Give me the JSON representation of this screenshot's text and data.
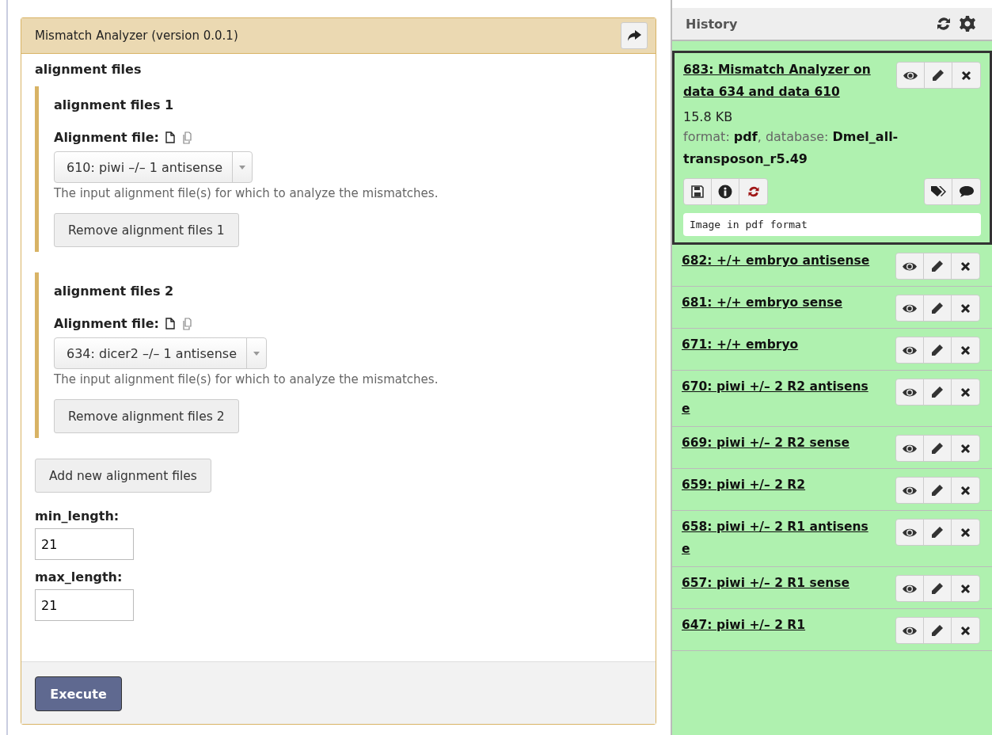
{
  "tool": {
    "title": "Mismatch Analyzer (version 0.0.1)",
    "section_title": "alignment files",
    "repeats": [
      {
        "title": "alignment files 1",
        "field_label": "Alignment file:",
        "value": "610: piwi –/– 1 antisense",
        "help": "The input alignment file(s) for which to analyze the mismatches.",
        "remove_button": "Remove alignment files 1"
      },
      {
        "title": "alignment files 2",
        "field_label": "Alignment file:",
        "value": "634: dicer2 –/– 1 antisense",
        "help": "The input alignment file(s) for which to analyze the mismatches.",
        "remove_button": "Remove alignment files 2"
      }
    ],
    "add_button": "Add new alignment files",
    "params": [
      {
        "label": "min_length:",
        "value": "21"
      },
      {
        "label": "max_length:",
        "value": "21"
      }
    ],
    "execute_button": "Execute"
  },
  "history": {
    "title": "History",
    "items": [
      {
        "title": "683: Mismatch Analyzer on data 634 and data 610",
        "expanded": true,
        "size": "15.8 KB",
        "info": "format: **pdf**, database: **Dmel_all-transposon_r5.49**",
        "peek": "Image in pdf format"
      },
      {
        "title": "682: +/+ embryo antisense",
        "expanded": false
      },
      {
        "title": "681: +/+ embryo sense",
        "expanded": false
      },
      {
        "title": "671: +/+ embryo",
        "expanded": false
      },
      {
        "title": "670: piwi +/– 2 R2 antisense",
        "expanded": false
      },
      {
        "title": "669: piwi +/– 2 R2 sense",
        "expanded": false
      },
      {
        "title": "659: piwi +/– 2 R2",
        "expanded": false
      },
      {
        "title": "658: piwi +/– 2 R1 antisense",
        "expanded": false
      },
      {
        "title": "657: piwi +/– 2 R1 sense",
        "expanded": false
      },
      {
        "title": "647: piwi +/– 2 R1",
        "expanded": false
      }
    ]
  }
}
